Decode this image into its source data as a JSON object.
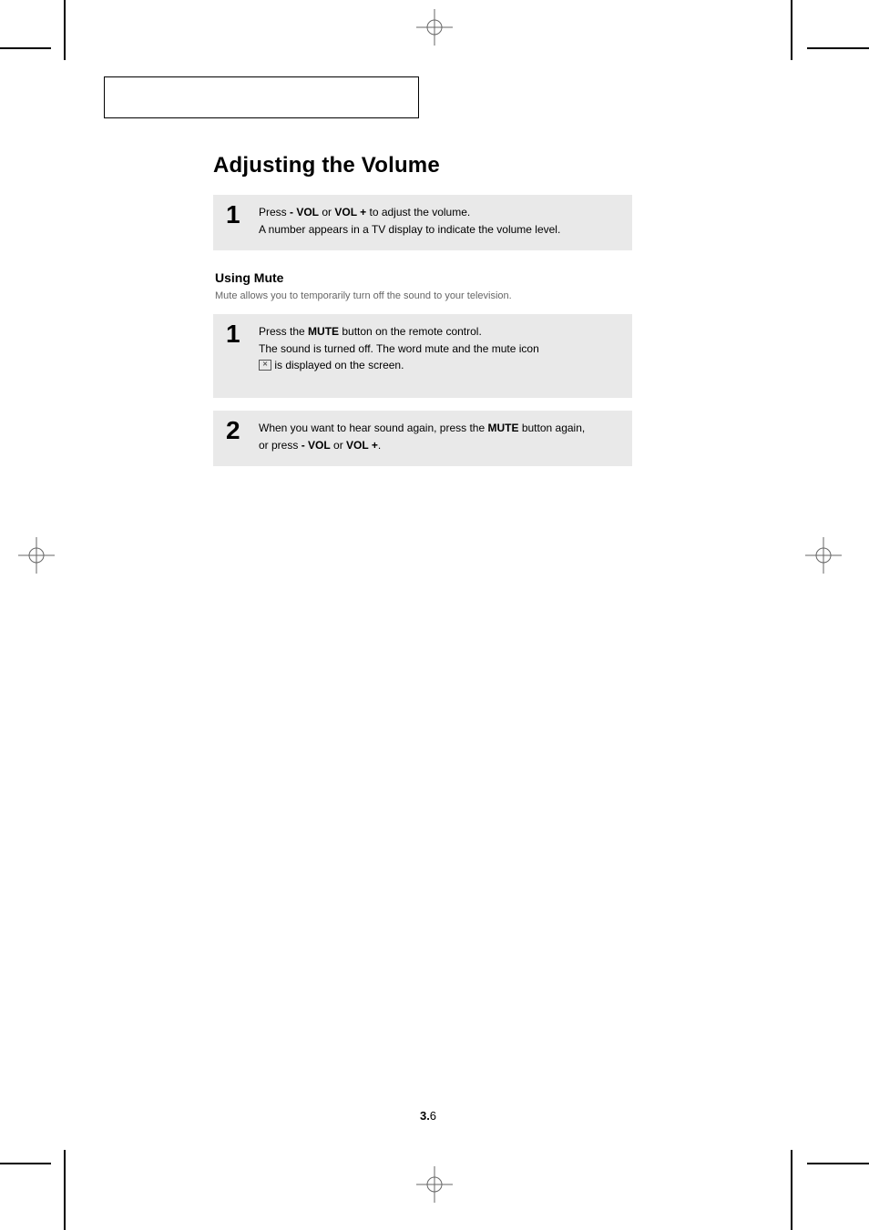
{
  "title": "Adjusting the Volume",
  "step_vol": {
    "num": "1",
    "line1_pre": "Press ",
    "vol_minus": "- VOL",
    "mid": " or ",
    "vol_plus": "VOL +",
    "line1_post": " to adjust the volume.",
    "line2": "A number appears in a TV display to indicate the volume level."
  },
  "mute_head": "Using Mute",
  "mute_desc": "Mute allows you to temporarily turn off the sound to your television.",
  "step_mute1": {
    "num": "1",
    "line1_pre": "Press the ",
    "mute": "MUTE",
    "line1_post": " button on the remote control.",
    "line2_pre": "The sound is turned off. The word ",
    "muteword": "mute",
    "line2_post": " and the mute icon",
    "line3": " is displayed on the screen."
  },
  "step_mute2": {
    "num": "2",
    "line1_pre": "When you want to hear sound again, press the ",
    "mute": "MUTE",
    "line1_post": " button again,",
    "line2_pre": "or press ",
    "vol_minus": "- VOL",
    "mid": " or ",
    "vol_plus": "VOL +",
    "line2_post": "."
  },
  "pagenum": {
    "chapter": "3.",
    "page": "6"
  }
}
